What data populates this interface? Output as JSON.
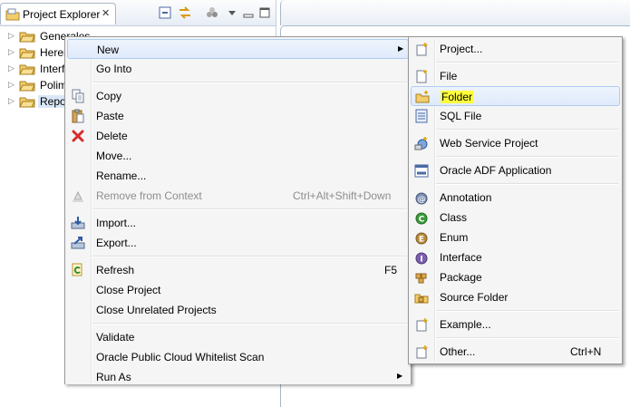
{
  "view": {
    "title": "Project Explorer",
    "close_glyph": "✕"
  },
  "tree": {
    "items": [
      {
        "label": "Generales"
      },
      {
        "label": "Herer"
      },
      {
        "label": "Interf"
      },
      {
        "label": "Polim"
      },
      {
        "label": "Repo"
      }
    ]
  },
  "context_menu": {
    "items": {
      "new": {
        "label": "New",
        "submenu": true
      },
      "go_into": {
        "label": "Go Into"
      },
      "copy": {
        "label": "Copy"
      },
      "paste": {
        "label": "Paste"
      },
      "delete": {
        "label": "Delete"
      },
      "move": {
        "label": "Move..."
      },
      "rename": {
        "label": "Rename..."
      },
      "remove_from_context": {
        "label": "Remove from Context",
        "accel": "Ctrl+Alt+Shift+Down",
        "disabled": true
      },
      "import": {
        "label": "Import..."
      },
      "export": {
        "label": "Export..."
      },
      "refresh": {
        "label": "Refresh",
        "accel": "F5"
      },
      "close_project": {
        "label": "Close Project"
      },
      "close_unrelated": {
        "label": "Close Unrelated Projects"
      },
      "validate": {
        "label": "Validate"
      },
      "oracle_scan": {
        "label": "Oracle Public Cloud Whitelist Scan"
      },
      "run_as": {
        "label": "Run As",
        "submenu": true
      }
    }
  },
  "new_submenu": {
    "items": {
      "project": {
        "label": "Project..."
      },
      "file": {
        "label": "File"
      },
      "folder": {
        "label": "Folder"
      },
      "sql_file": {
        "label": "SQL File"
      },
      "web_service_project": {
        "label": "Web Service Project"
      },
      "oracle_adf_application": {
        "label": "Oracle ADF Application"
      },
      "annotation": {
        "label": "Annotation"
      },
      "class": {
        "label": "Class"
      },
      "enum": {
        "label": "Enum"
      },
      "interface": {
        "label": "Interface"
      },
      "package": {
        "label": "Package"
      },
      "source_folder": {
        "label": "Source Folder"
      },
      "example": {
        "label": "Example..."
      },
      "other": {
        "label": "Other...",
        "accel": "Ctrl+N"
      }
    }
  },
  "colors": {
    "highlight": "#ffff3c",
    "hover_border": "#aeccf1",
    "disabled_text": "#8d8d8d"
  }
}
